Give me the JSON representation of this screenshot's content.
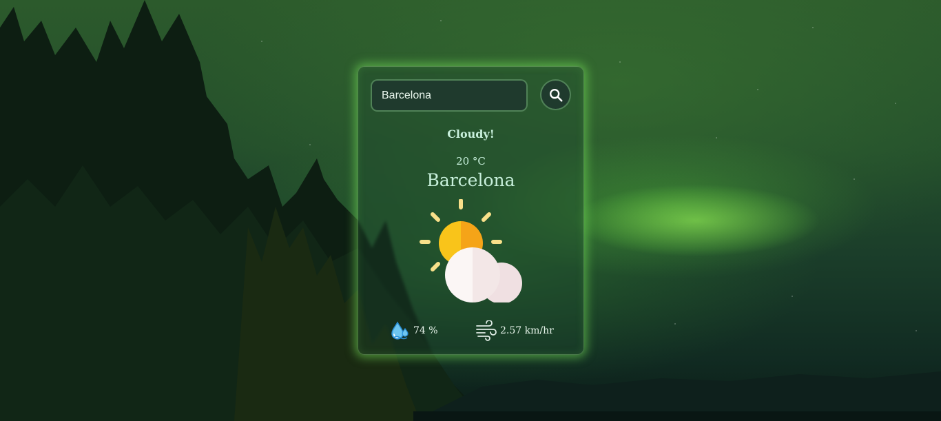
{
  "search": {
    "value": "Barcelona",
    "button_icon": "search-icon"
  },
  "weather": {
    "condition": "Cloudy!",
    "temperature": "20 °C",
    "city": "Barcelona",
    "icon": "partly-cloudy-icon"
  },
  "stats": {
    "humidity": "74 %",
    "humidity_icon": "humidity-drop-icon",
    "wind": "2.57 km/hr",
    "wind_icon": "wind-icon"
  },
  "colors": {
    "card_glow": "#78e65a",
    "text": "#c8f0dc",
    "sun": "#f9c41a",
    "cloud": "#f5ecec"
  }
}
